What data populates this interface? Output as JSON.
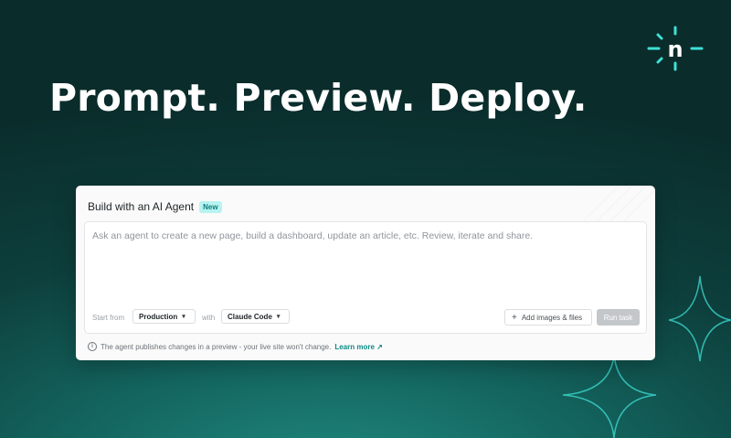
{
  "brand": {
    "logo_letter": "n",
    "accent_color": "#3fe0d6"
  },
  "hero": {
    "headline": "Prompt. Preview. Deploy."
  },
  "card": {
    "title": "Build with an AI Agent",
    "badge": "New",
    "prompt_placeholder": "Ask an agent to create a new page, build a dashboard, update an article, etc. Review, iterate and share.",
    "start_from_label": "Start from",
    "start_from_value": "Production",
    "with_label": "with",
    "agent_value": "Claude Code",
    "add_button_label": "Add images & files",
    "run_button_label": "Run task",
    "footer_text": "The agent publishes changes in a preview - your live site won't change.",
    "learn_more_label": "Learn more ↗"
  },
  "icons": {
    "logo": "netlify-logo-icon",
    "info": "info-icon",
    "plus": "plus-icon",
    "chevron": "chevron-down-icon",
    "decor": "sparkle-star-icon"
  }
}
